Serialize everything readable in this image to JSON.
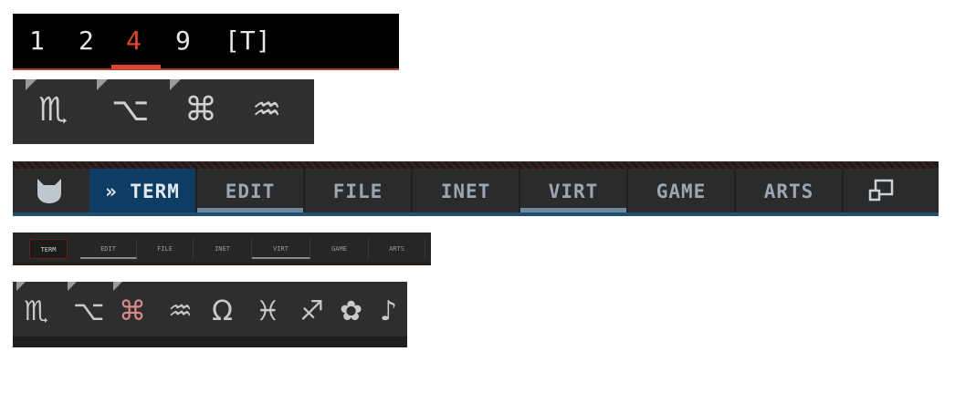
{
  "workspaces": {
    "items": [
      "1",
      "2",
      "4",
      "9",
      "[T]"
    ],
    "active_index": 2,
    "active_color": "#e0452f"
  },
  "glyph_bar": {
    "glyphs": [
      "♏",
      "⌥",
      "⌘",
      "♒"
    ]
  },
  "main_tabs": {
    "logo": "cat-logo-icon",
    "tabs": [
      "» TERM",
      "EDIT",
      "FILE",
      "INET",
      "VIRT",
      "GAME",
      "ARTS"
    ],
    "active": "TERM",
    "window_icon": "window-restore-icon",
    "active_color": "#0f3c63",
    "accent_line_color": "#1e4e70"
  },
  "mini_tabs": {
    "tabs": [
      "TERM",
      "EDIT",
      "FILE",
      "INET",
      "VIRT",
      "GAME",
      "ARTS"
    ],
    "active": "TERM"
  },
  "icon_bar": {
    "glyphs": [
      "♏",
      "⌥",
      "⌘",
      "♒",
      "Ω",
      "♓",
      "♐",
      "✿",
      "♪"
    ],
    "active_index": 2
  }
}
